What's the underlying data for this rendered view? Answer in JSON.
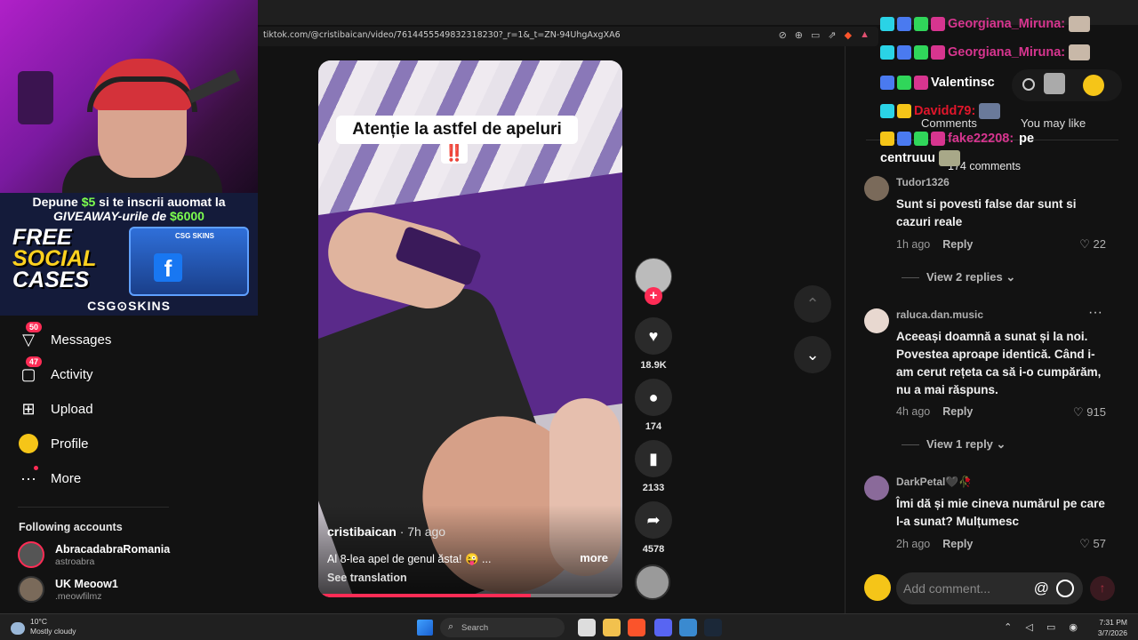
{
  "browser": {
    "url": "tiktok.com/@cristibaican/video/7614455549832318230?_r=1&_t=ZN-94UhgAxgXA6"
  },
  "overlay": {
    "promo_line1_a": "Depune ",
    "promo_line1_amount": "$5",
    "promo_line1_b": " si te inscrii auomat la",
    "promo_line2_a": "GIVEAWAY-urile de ",
    "promo_line2_amount": "$6000",
    "promo_free_1": "FREE",
    "promo_free_2": "SOCIAL",
    "promo_free_3": "CASES",
    "promo_box_label": "CSG SKINS",
    "promo_box_fb": "f",
    "promo_brand": "CSG⊙SKINS"
  },
  "chat": [
    {
      "name": "Georgiana_Miruna:"
    },
    {
      "name": "Georgiana_Miruna:"
    },
    {
      "name": "Valentinsc"
    },
    {
      "name": "Davidd79:"
    },
    {
      "name": "fake22208:",
      "message": "pe"
    },
    {
      "message": "centruuu"
    }
  ],
  "sidebar": {
    "items": [
      {
        "label": "Messages",
        "badge": "50",
        "icon": "paper-plane-icon"
      },
      {
        "label": "Activity",
        "badge": "47",
        "icon": "inbox-icon"
      },
      {
        "label": "Upload",
        "icon": "plus-square-icon"
      },
      {
        "label": "Profile",
        "icon": "avatar-icon"
      },
      {
        "label": "More",
        "icon": "more-dots-icon"
      }
    ],
    "following_title": "Following accounts",
    "accounts": [
      {
        "name": "AbracadabraRomania",
        "handle": "astroabra"
      },
      {
        "name": "UK Meoow1",
        "handle": ".meowfilmz"
      }
    ]
  },
  "video": {
    "caption": "Atenție la astfel de apeluri",
    "caption_mark": "‼️",
    "author": "cristibaican",
    "posted": " · 7h ago",
    "description": "Al 8-lea apel de genul ăsta! 😜 ...",
    "more": "more",
    "translation": "See translation",
    "progress": 0.7
  },
  "actions": {
    "likes": "18.9K",
    "comments": "174",
    "saves": "2133",
    "shares": "4578"
  },
  "comments_panel": {
    "tab_comments": "Comments",
    "tab_like": "You may like",
    "count_label": "174 comments",
    "items": [
      {
        "user": "Tudor1326",
        "text": "Sunt si povesti false dar sunt si cazuri reale",
        "time": "1h ago",
        "reply": "Reply",
        "likes": "22"
      },
      {
        "user": "raluca.dan.music",
        "text": "Aceeași doamnă a sunat și la noi. Povestea aproape identică. Când i-am cerut rețeta ca să i-o cumpărăm, nu a mai răspuns.",
        "time": "4h ago",
        "reply": "Reply",
        "likes": "915"
      },
      {
        "user": "DarkPetal🖤🥀",
        "text": "Îmi dă și mie cineva numărul pe care l-a sunat? Mulțumesc",
        "time": "2h ago",
        "reply": "Reply",
        "likes": "57"
      }
    ],
    "view_replies_1": "View 2 replies ⌄",
    "view_replies_2": "View 1 reply ⌄",
    "add_placeholder": "Add comment...",
    "at_symbol": "@"
  },
  "taskbar": {
    "temp": "10°C",
    "weather": "Mostly cloudy",
    "search": "Search",
    "time": "7:31 PM",
    "date": "3/7/2026"
  },
  "colors": {
    "accent": "#fe2c55",
    "background": "#121212"
  }
}
